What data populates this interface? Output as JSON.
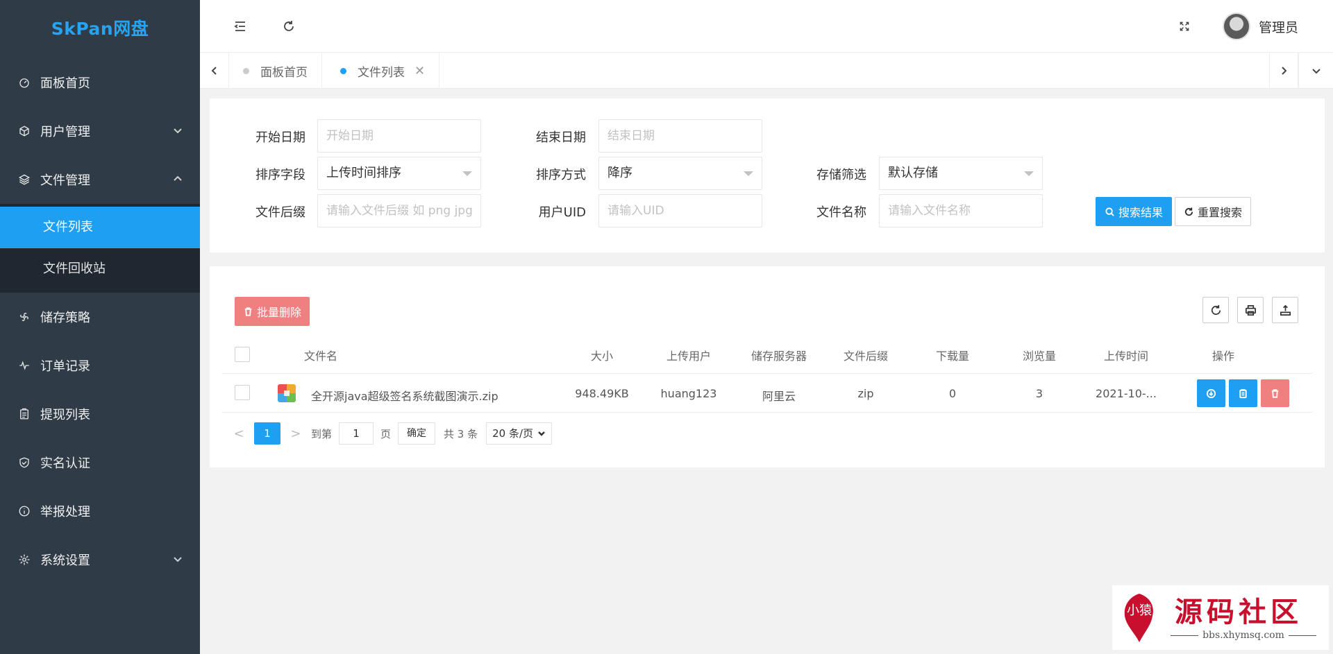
{
  "app": {
    "logo": "SkPan网盘"
  },
  "sidebar": {
    "items": [
      {
        "label": "面板首页"
      },
      {
        "label": "用户管理"
      },
      {
        "label": "文件管理"
      },
      {
        "label": "储存策略"
      },
      {
        "label": "订单记录"
      },
      {
        "label": "提现列表"
      },
      {
        "label": "实名认证"
      },
      {
        "label": "举报处理"
      },
      {
        "label": "系统设置"
      }
    ],
    "file_submenu": [
      {
        "label": "文件列表",
        "active": true
      },
      {
        "label": "文件回收站"
      }
    ]
  },
  "header": {
    "user_name": "管理员"
  },
  "tabs": [
    {
      "label": "面板首页"
    },
    {
      "label": "文件列表",
      "close": "✕"
    }
  ],
  "search": {
    "start_date_label": "开始日期",
    "start_date_placeholder": "开始日期",
    "end_date_label": "结束日期",
    "end_date_placeholder": "结束日期",
    "sort_field_label": "排序字段",
    "sort_field_value": "上传时间排序",
    "sort_order_label": "排序方式",
    "sort_order_value": "降序",
    "storage_label": "存储筛选",
    "storage_value": "默认存储",
    "suffix_label": "文件后缀",
    "suffix_placeholder": "请输入文件后缀 如 png jpg 等",
    "uid_label": "用户UID",
    "uid_placeholder": "请输入UID",
    "filename_label": "文件名称",
    "filename_placeholder": "请输入文件名称",
    "search_button": "搜索结果",
    "reset_button": "重置搜索"
  },
  "table": {
    "batch_delete": "批量删除",
    "columns": [
      "文件名",
      "大小",
      "上传用户",
      "储存服务器",
      "文件后缀",
      "下载量",
      "浏览量",
      "上传时间",
      "操作"
    ],
    "rows": [
      {
        "name": "全开源java超级签名系统截图演示.zip",
        "size": "948.49KB",
        "user": "huang123",
        "server": "阿里云",
        "suffix": "zip",
        "downloads": "0",
        "views": "3",
        "time": "2021-10-..."
      }
    ]
  },
  "pager": {
    "prev": "<",
    "current": "1",
    "next": ">",
    "goto_label": "到第",
    "goto_value": "1",
    "page_unit": "页",
    "confirm": "确定",
    "total": "共 3 条",
    "page_size": "20 条/页"
  },
  "watermark": {
    "title": "源码社区",
    "subtitle": "bbs.xhymsq.com",
    "seal_text": "小猿"
  },
  "colors": {
    "sidebar_bg": "#2f3b46",
    "submenu_bg": "#1f2830",
    "accent": "#1e9ff2",
    "danger": "#f07f7f",
    "logo": "#27a4f0"
  }
}
